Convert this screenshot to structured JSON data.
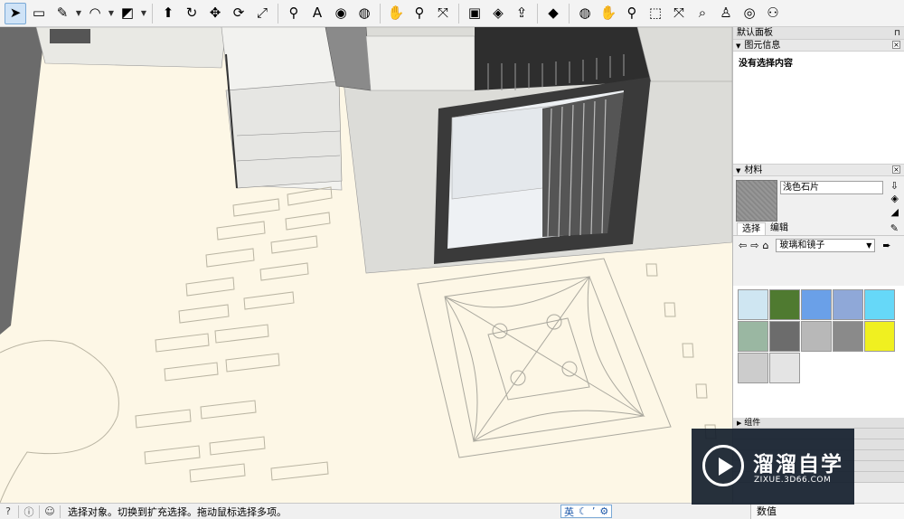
{
  "toolbar": {
    "tools": [
      {
        "name": "select-tool",
        "glyph": "➤",
        "active": true
      },
      {
        "name": "eraser-tool",
        "glyph": "▭"
      },
      {
        "name": "pencil-tool",
        "glyph": "✎",
        "dropdown": true
      },
      {
        "name": "arc-tool",
        "glyph": "◠",
        "dropdown": true
      },
      {
        "name": "rectangle-tool",
        "glyph": "◩",
        "dropdown": true
      },
      {
        "name": "push-pull-tool",
        "glyph": "⬆"
      },
      {
        "name": "follow-me-tool",
        "glyph": "↻"
      },
      {
        "name": "move-tool",
        "glyph": "✥"
      },
      {
        "name": "rotate-tool",
        "glyph": "⟳"
      },
      {
        "name": "scale-tool",
        "glyph": "⤢"
      },
      {
        "name": "tape-measure-tool",
        "glyph": "⚲"
      },
      {
        "name": "text-tool",
        "glyph": "A"
      },
      {
        "name": "paint-bucket-tool",
        "glyph": "◉"
      },
      {
        "name": "orbit-tool",
        "glyph": "◍"
      },
      {
        "name": "pan-tool",
        "glyph": "✋"
      },
      {
        "name": "zoom-tool",
        "glyph": "⚲"
      },
      {
        "name": "zoom-extents-tool",
        "glyph": "⤧"
      },
      {
        "name": "warehouse-tool",
        "glyph": "▣"
      },
      {
        "name": "extension-tool",
        "glyph": "◈"
      },
      {
        "name": "share-tool",
        "glyph": "⇪"
      },
      {
        "name": "ruby-tool",
        "glyph": "◆"
      },
      {
        "name": "orbit-tool-2",
        "glyph": "◍"
      },
      {
        "name": "pan-tool-2",
        "glyph": "✋"
      },
      {
        "name": "zoom-tool-2",
        "glyph": "⚲"
      },
      {
        "name": "zoom-window-tool",
        "glyph": "⬚"
      },
      {
        "name": "zoom-extents-tool-2",
        "glyph": "⤧"
      },
      {
        "name": "previous-view-tool",
        "glyph": "⌕"
      },
      {
        "name": "position-camera-tool",
        "glyph": "♙"
      },
      {
        "name": "look-around-tool",
        "glyph": "◎"
      },
      {
        "name": "walk-tool",
        "glyph": "⚇"
      }
    ]
  },
  "tray": {
    "title": "默认面板",
    "pin": "⊓",
    "entity_info": {
      "header": "图元信息",
      "body": "没有选择内容"
    },
    "materials": {
      "header": "材料",
      "material_name": "浅色石片",
      "tab_select": "选择",
      "tab_edit": "编辑",
      "library": "玻璃和镜子",
      "swatches": [
        "#cfe6f2",
        "#4f7a30",
        "#6aa0e8",
        "#8fa8d8",
        "#66d8f8",
        "#9ab7a2",
        "#6c6c6c",
        "#b8b8b8",
        "#8a8a8a",
        "#f0f020",
        "#cccccc",
        "#e4e4e4"
      ]
    },
    "components_header": "组件"
  },
  "statusbar": {
    "text": "选择对象。切换到扩充选择。拖动鼠标选择多项。",
    "ime": "英",
    "value_label": "数值"
  },
  "watermark": {
    "cn": "溜溜自学",
    "en": "ZIXUE.3D66.COM"
  }
}
